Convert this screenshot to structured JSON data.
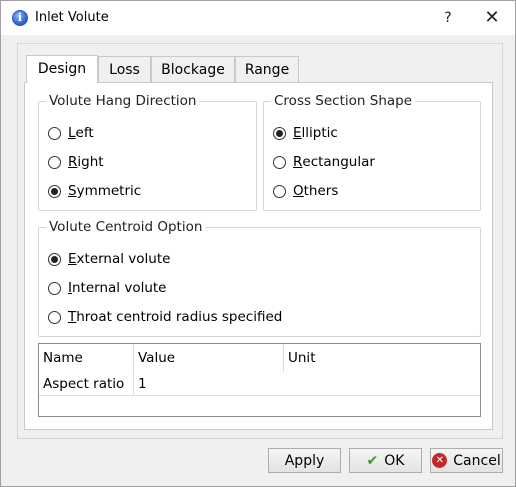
{
  "window": {
    "title": "Inlet Volute",
    "help_label": "?",
    "close_label": "✕"
  },
  "tabs": [
    {
      "label": "Design",
      "active": true
    },
    {
      "label": "Loss",
      "active": false
    },
    {
      "label": "Blockage",
      "active": false
    },
    {
      "label": "Range",
      "active": false
    }
  ],
  "hang_direction": {
    "title": "Volute Hang Direction",
    "options": [
      {
        "mnemonic": "L",
        "rest": "eft",
        "checked": false
      },
      {
        "mnemonic": "R",
        "rest": "ight",
        "checked": false
      },
      {
        "mnemonic": "S",
        "rest": "ymmetric",
        "checked": true
      }
    ]
  },
  "cross_section": {
    "title": "Cross Section Shape",
    "options": [
      {
        "mnemonic": "E",
        "rest": "lliptic",
        "checked": true
      },
      {
        "mnemonic": "R",
        "rest": "ectangular",
        "checked": false
      },
      {
        "mnemonic": "O",
        "rest": "thers",
        "checked": false
      }
    ]
  },
  "centroid_option": {
    "title": "Volute Centroid Option",
    "options": [
      {
        "mnemonic": "E",
        "rest": "xternal volute",
        "checked": true
      },
      {
        "mnemonic": "I",
        "rest": "nternal volute",
        "checked": false
      },
      {
        "mnemonic": "T",
        "rest": "hroat centroid radius specified",
        "checked": false
      }
    ]
  },
  "table": {
    "headers": [
      "Name",
      "Value",
      "Unit"
    ],
    "rows": [
      [
        "Aspect ratio",
        "1",
        ""
      ]
    ]
  },
  "buttons": {
    "apply": "Apply",
    "ok": "OK",
    "cancel": "Cancel"
  },
  "icons": {
    "title": "info-icon",
    "ok": "check-icon",
    "cancel": "cancel-circle-icon"
  }
}
